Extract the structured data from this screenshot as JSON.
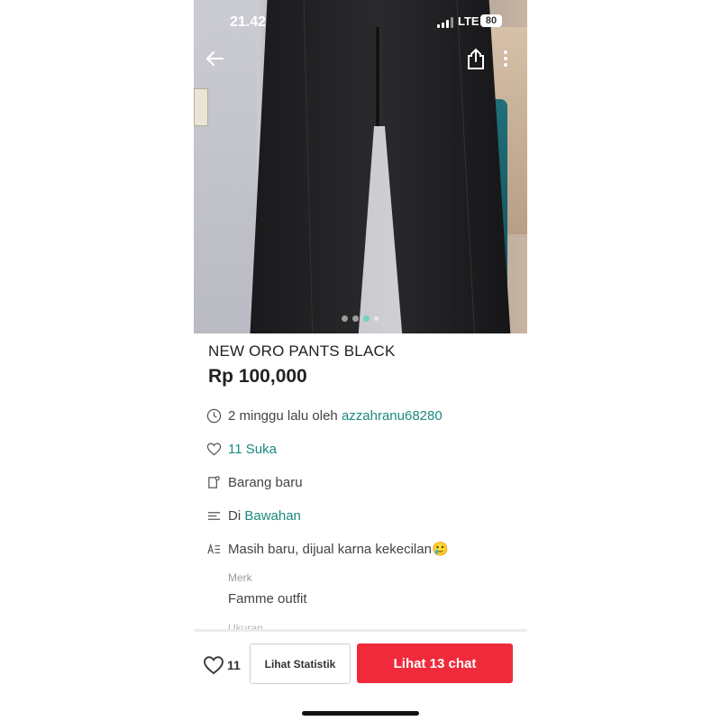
{
  "status_bar": {
    "time": "21.42",
    "network": "LTE",
    "battery": "80"
  },
  "product": {
    "title": "NEW ORO PANTS BLACK",
    "price": "Rp 100,000",
    "image_carousel": {
      "count": 4,
      "active_index": 2
    }
  },
  "details": {
    "posted_time": "2 minggu lalu oleh",
    "seller": "azzahranu68280",
    "likes_label": "11 Suka",
    "condition": "Barang baru",
    "category_prefix": "Di",
    "category": "Bawahan",
    "description": "Masih baru, dijual karna kekecilan🥲",
    "brand_label": "Merk",
    "brand": "Famme outfit",
    "size_label": "Ukuran"
  },
  "bottom_bar": {
    "like_count": "11",
    "stats_button": "Lihat Statistik",
    "chat_button": "Lihat 13 chat"
  },
  "colors": {
    "accent_link": "#1b8a7e",
    "chat_button": "#ef2b3b"
  },
  "icons": [
    "back-arrow-icon",
    "share-icon",
    "more-vertical-icon",
    "clock-icon",
    "heart-icon",
    "tag-icon",
    "list-icon",
    "text-icon"
  ]
}
